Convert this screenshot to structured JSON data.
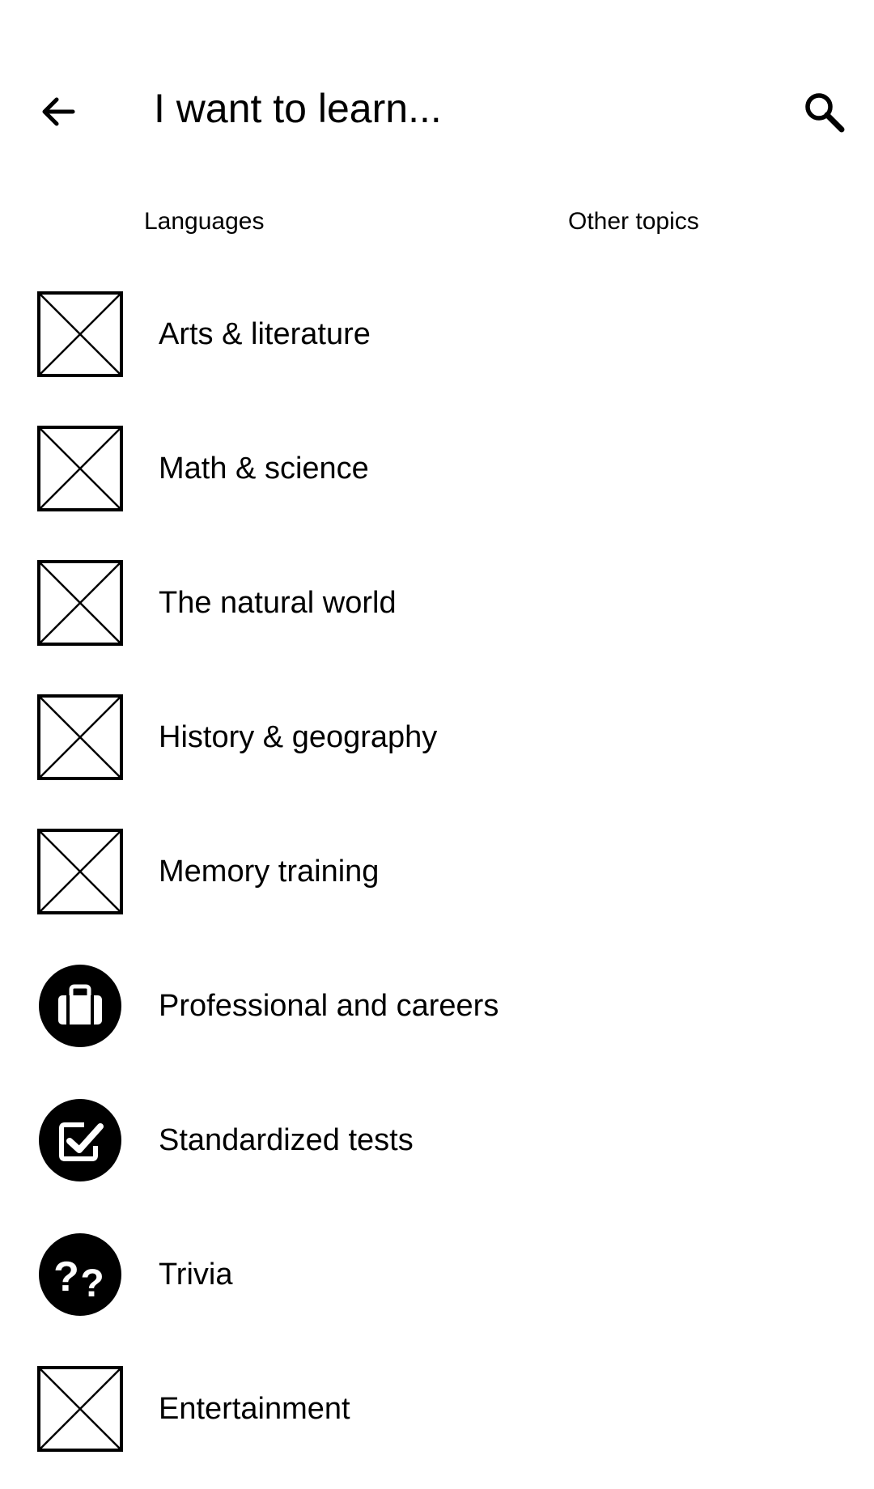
{
  "header": {
    "title": "I want to learn...",
    "back_icon": "arrow-left-icon",
    "search_icon": "search-icon"
  },
  "tabs": [
    {
      "label": "Languages"
    },
    {
      "label": "Other topics"
    }
  ],
  "topics": [
    {
      "label": "Arts & literature",
      "icon": "placeholder-image-icon"
    },
    {
      "label": "Math & science",
      "icon": "placeholder-image-icon"
    },
    {
      "label": "The natural world",
      "icon": "placeholder-image-icon"
    },
    {
      "label": "History & geography",
      "icon": "placeholder-image-icon"
    },
    {
      "label": "Memory training",
      "icon": "placeholder-image-icon"
    },
    {
      "label": "Professional and careers",
      "icon": "briefcase-icon"
    },
    {
      "label": "Standardized tests",
      "icon": "checkbox-icon"
    },
    {
      "label": "Trivia",
      "icon": "question-marks-icon"
    },
    {
      "label": "Entertainment",
      "icon": "placeholder-image-icon"
    }
  ]
}
